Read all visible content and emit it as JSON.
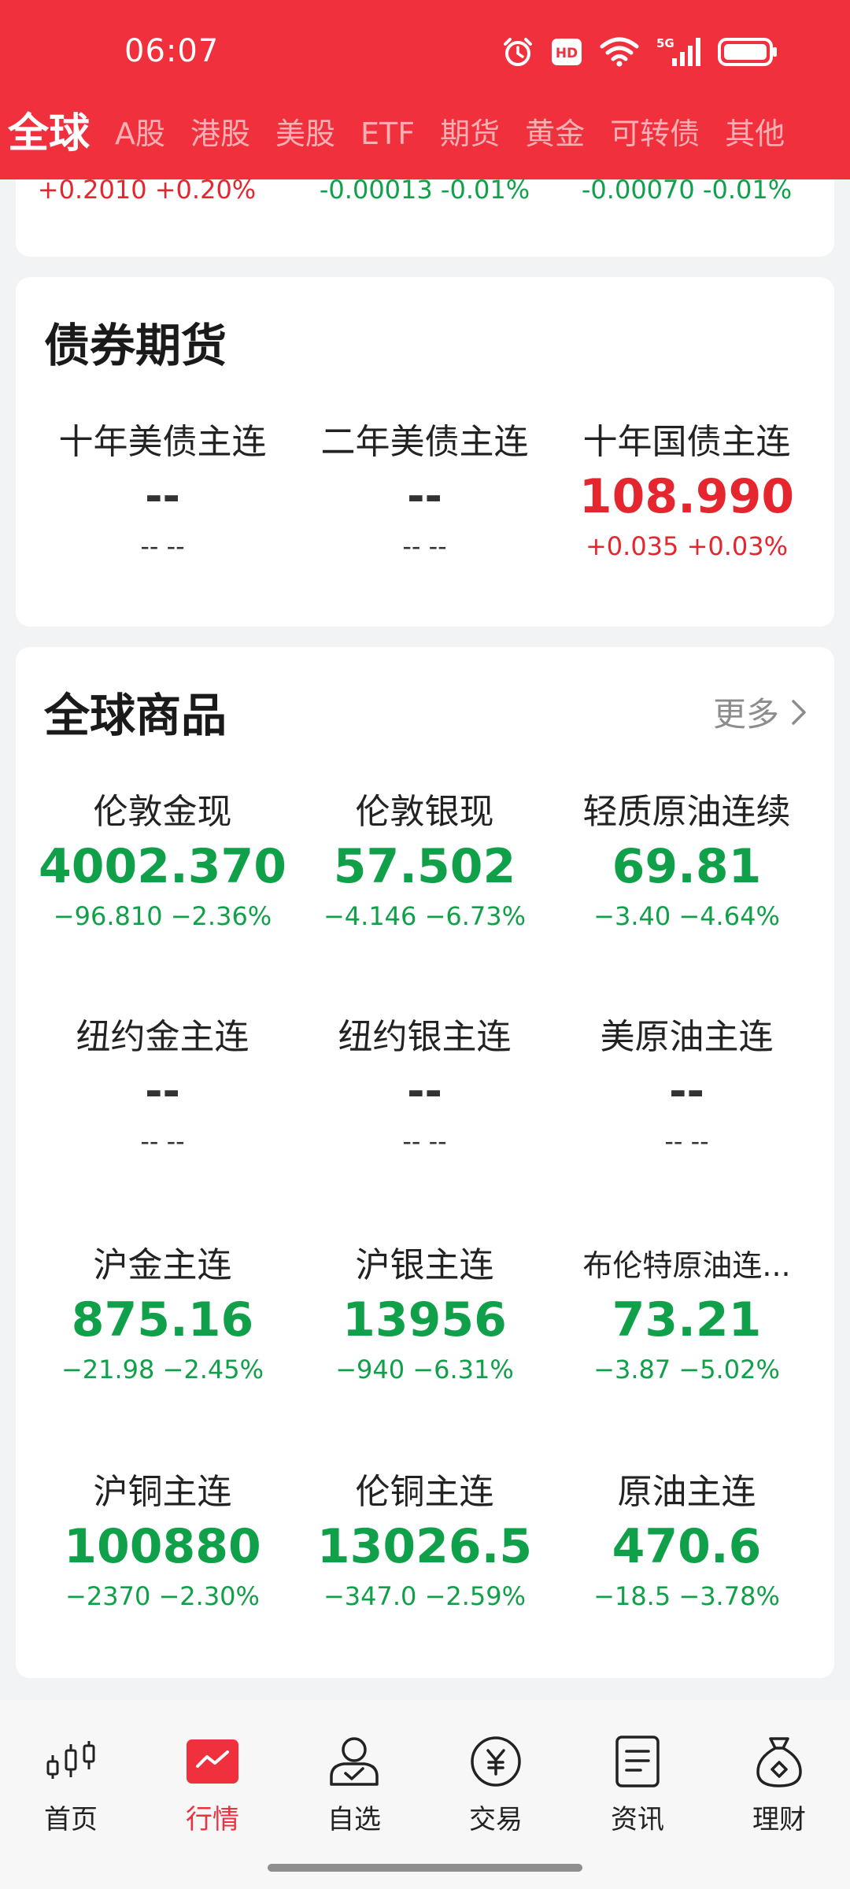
{
  "status_bar": {
    "time": "06:07",
    "icons": [
      "alarm-icon",
      "hd-icon",
      "wifi-icon",
      "signal-5g-icon",
      "battery-icon"
    ],
    "network_label": "5G",
    "hd_label": "HD"
  },
  "tabs": [
    {
      "label": "全球",
      "active": true
    },
    {
      "label": "A股"
    },
    {
      "label": "港股"
    },
    {
      "label": "美股"
    },
    {
      "label": "ETF"
    },
    {
      "label": "期货"
    },
    {
      "label": "黄金"
    },
    {
      "label": "可转债"
    },
    {
      "label": "其他"
    }
  ],
  "top_partial": {
    "items": [
      {
        "change": "+0.2010 +0.20%",
        "color": "#e5262f"
      },
      {
        "change": "-0.00013 -0.01%",
        "color": "#11a04a"
      },
      {
        "change": "-0.00070 -0.01%",
        "color": "#11a04a"
      }
    ]
  },
  "bond_futures": {
    "title": "债券期货",
    "items": [
      {
        "name": "十年美债主连",
        "price": "--",
        "change": "-- --",
        "trend": "none"
      },
      {
        "name": "二年美债主连",
        "price": "--",
        "change": "-- --",
        "trend": "none"
      },
      {
        "name": "十年国债主连",
        "price": "108.990",
        "change": "+0.035 +0.03%",
        "trend": "up"
      }
    ]
  },
  "global_commodities": {
    "title": "全球商品",
    "more_label": "更多",
    "items": [
      {
        "name": "伦敦金现",
        "price": "4002.370",
        "change": "−96.810 −2.36%",
        "trend": "down"
      },
      {
        "name": "伦敦银现",
        "price": "57.502",
        "change": "−4.146 −6.73%",
        "trend": "down"
      },
      {
        "name": "轻质原油连续",
        "price": "69.81",
        "change": "−3.40 −4.64%",
        "trend": "down"
      },
      {
        "name": "纽约金主连",
        "price": "--",
        "change": "-- --",
        "trend": "none"
      },
      {
        "name": "纽约银主连",
        "price": "--",
        "change": "-- --",
        "trend": "none"
      },
      {
        "name": "美原油主连",
        "price": "--",
        "change": "-- --",
        "trend": "none"
      },
      {
        "name": "沪金主连",
        "price": "875.16",
        "change": "−21.98 −2.45%",
        "trend": "down"
      },
      {
        "name": "沪银主连",
        "price": "13956",
        "change": "−940 −6.31%",
        "trend": "down"
      },
      {
        "name": "布伦特原油连...",
        "price": "73.21",
        "change": "−3.87 −5.02%",
        "trend": "down"
      },
      {
        "name": "沪铜主连",
        "price": "100880",
        "change": "−2370 −2.30%",
        "trend": "down"
      },
      {
        "name": "伦铜主连",
        "price": "13026.5",
        "change": "−347.0 −2.59%",
        "trend": "down"
      },
      {
        "name": "原油主连",
        "price": "470.6",
        "change": "−18.5 −3.78%",
        "trend": "down"
      }
    ]
  },
  "bottom_nav": [
    {
      "label": "首页",
      "icon": "candlestick-icon",
      "active": false
    },
    {
      "label": "行情",
      "icon": "market-chart-icon",
      "active": true
    },
    {
      "label": "自选",
      "icon": "watchlist-user-icon",
      "active": false
    },
    {
      "label": "交易",
      "icon": "yuan-coin-icon",
      "active": false
    },
    {
      "label": "资讯",
      "icon": "news-doc-icon",
      "active": false
    },
    {
      "label": "理财",
      "icon": "money-bag-icon",
      "active": false
    }
  ],
  "colors": {
    "brand": "#f0313d",
    "up": "#e5262f",
    "down": "#11a04a"
  }
}
